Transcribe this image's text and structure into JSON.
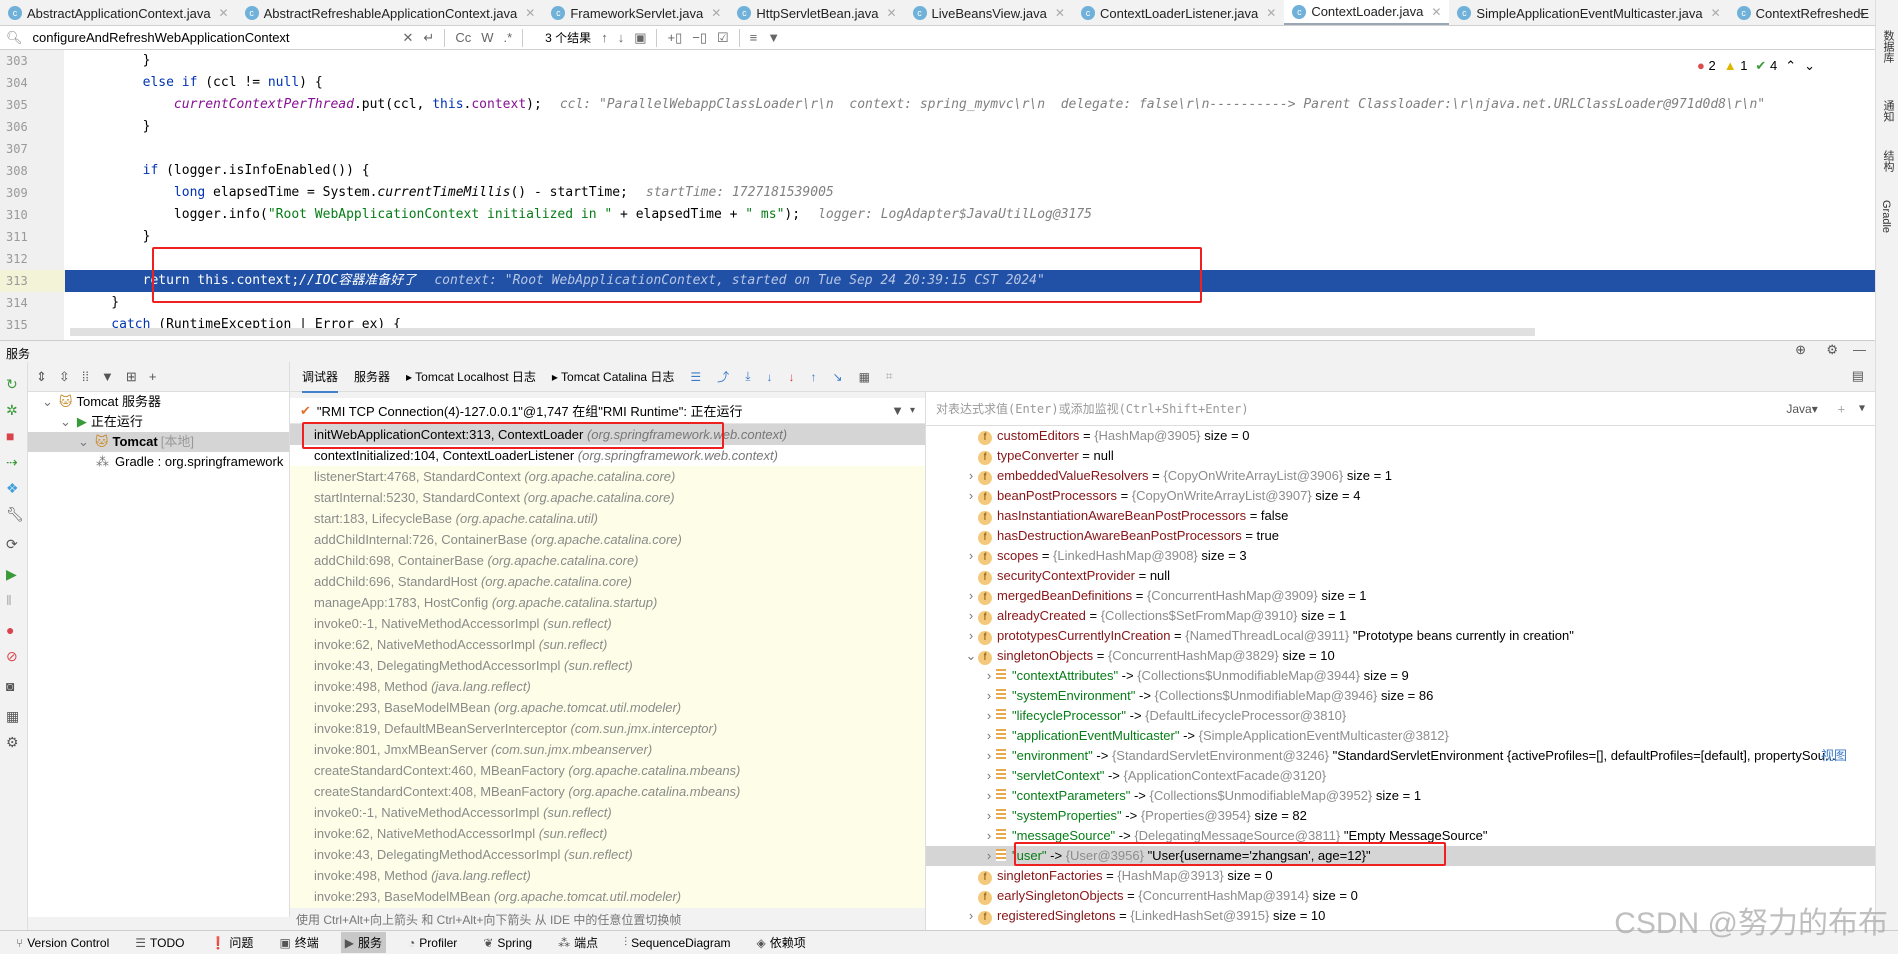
{
  "tabs": [
    {
      "label": "AbstractApplicationContext.java",
      "active": false
    },
    {
      "label": "AbstractRefreshableApplicationContext.java",
      "active": false
    },
    {
      "label": "FrameworkServlet.java",
      "active": false
    },
    {
      "label": "HttpServletBean.java",
      "active": false
    },
    {
      "label": "LiveBeansView.java",
      "active": false
    },
    {
      "label": "ContextLoaderListener.java",
      "active": false
    },
    {
      "label": "ContextLoader.java",
      "active": true
    },
    {
      "label": "SimpleApplicationEventMulticaster.java",
      "active": false
    },
    {
      "label": "ContextRefreshedE",
      "active": false
    }
  ],
  "search": {
    "value": "configureAndRefreshWebApplicationContext",
    "results": "3 个结果",
    "cc": "Cc",
    "w": "W",
    "regex": ".*"
  },
  "inspections": {
    "errors": "2",
    "warnings": "1",
    "ok": "4"
  },
  "code": [
    {
      "n": "303",
      "segs": [
        {
          "k": "",
          "t": "        }"
        }
      ]
    },
    {
      "n": "304",
      "segs": [
        {
          "k": "kw",
          "t": "        else if"
        },
        {
          "k": "",
          "t": " (ccl != "
        },
        {
          "k": "kw",
          "t": "null"
        },
        {
          "k": "",
          "t": ") {"
        }
      ]
    },
    {
      "n": "305",
      "segs": [
        {
          "k": "fld it",
          "t": "            currentContextPerThread"
        },
        {
          "k": "",
          "t": ".put(ccl, "
        },
        {
          "k": "kw",
          "t": "this"
        },
        {
          "k": "",
          "t": "."
        },
        {
          "k": "fld",
          "t": "context"
        },
        {
          "k": "",
          "t": ");"
        },
        {
          "k": "hint",
          "t": "ccl: \"ParallelWebappClassLoader\\r\\n  context: spring_mymvc\\r\\n  delegate: false\\r\\n----------> Parent Classloader:\\r\\njava.net.URLClassLoader@971d0d8\\r\\n\""
        }
      ]
    },
    {
      "n": "306",
      "segs": [
        {
          "k": "",
          "t": "        }"
        }
      ]
    },
    {
      "n": "307",
      "segs": []
    },
    {
      "n": "308",
      "segs": [
        {
          "k": "kw",
          "t": "        if"
        },
        {
          "k": "",
          "t": " (logger.isInfoEnabled()) {"
        }
      ]
    },
    {
      "n": "309",
      "segs": [
        {
          "k": "kw",
          "t": "            long"
        },
        {
          "k": "",
          "t": " elapsedTime = System."
        },
        {
          "k": "it",
          "t": "currentTimeMillis"
        },
        {
          "k": "",
          "t": "() - startTime;"
        },
        {
          "k": "hint",
          "t": "startTime: 1727181539005"
        }
      ]
    },
    {
      "n": "310",
      "segs": [
        {
          "k": "",
          "t": "            logger.info("
        },
        {
          "k": "str",
          "t": "\"Root WebApplicationContext initialized in \""
        },
        {
          "k": "",
          "t": " + elapsedTime + "
        },
        {
          "k": "str",
          "t": "\" ms\""
        },
        {
          "k": "",
          "t": ");"
        },
        {
          "k": "hint",
          "t": "logger: LogAdapter$JavaUtilLog@3175"
        }
      ]
    },
    {
      "n": "311",
      "segs": [
        {
          "k": "",
          "t": "        }"
        }
      ]
    },
    {
      "n": "312",
      "segs": []
    },
    {
      "n": "313",
      "cur": true,
      "segs": [
        {
          "k": "kw",
          "t": "        return this"
        },
        {
          "k": "",
          "t": ".context;"
        },
        {
          "k": "it",
          "t": "//IOC容器准备好了"
        },
        {
          "k": "hint",
          "t": "context: \"Root WebApplicationContext, started on Tue Sep 24 20:39:15 CST 2024\""
        }
      ]
    },
    {
      "n": "314",
      "segs": [
        {
          "k": "",
          "t": "    }"
        }
      ]
    },
    {
      "n": "315",
      "segs": [
        {
          "k": "kw",
          "t": "    catch"
        },
        {
          "k": "",
          "t": " (RuntimeException | Error ex) {"
        }
      ]
    }
  ],
  "services": {
    "title": "服务",
    "tree": [
      {
        "label": "Tomcat 服务器",
        "indent": 1
      },
      {
        "label": "正在运行",
        "indent": 2
      },
      {
        "label": "Tomcat",
        "extra": "[本地]",
        "indent": 3,
        "selected": true
      },
      {
        "label": "Gradle : org.springframework",
        "indent": 4
      }
    ]
  },
  "debug_tabs": [
    "调试器",
    "服务器",
    "Tomcat Localhost 日志",
    "Tomcat Catalina 日志"
  ],
  "thread": "\"RMI TCP Connection(4)-127.0.0.1\"@1,747 在组\"RMI Runtime\": 正在运行",
  "frames": [
    {
      "m": "initWebApplicationContext:313, ContextLoader",
      "p": "(org.springframework.web.context)"
    },
    {
      "m": "contextInitialized:104, ContextLoaderListener",
      "p": "(org.springframework.web.context)"
    },
    {
      "m": "listenerStart:4768, StandardContext",
      "p": "(org.apache.catalina.core)"
    },
    {
      "m": "startInternal:5230, StandardContext",
      "p": "(org.apache.catalina.core)"
    },
    {
      "m": "start:183, LifecycleBase",
      "p": "(org.apache.catalina.util)"
    },
    {
      "m": "addChildInternal:726, ContainerBase",
      "p": "(org.apache.catalina.core)"
    },
    {
      "m": "addChild:698, ContainerBase",
      "p": "(org.apache.catalina.core)"
    },
    {
      "m": "addChild:696, StandardHost",
      "p": "(org.apache.catalina.core)"
    },
    {
      "m": "manageApp:1783, HostConfig",
      "p": "(org.apache.catalina.startup)"
    },
    {
      "m": "invoke0:-1, NativeMethodAccessorImpl",
      "p": "(sun.reflect)"
    },
    {
      "m": "invoke:62, NativeMethodAccessorImpl",
      "p": "(sun.reflect)"
    },
    {
      "m": "invoke:43, DelegatingMethodAccessorImpl",
      "p": "(sun.reflect)"
    },
    {
      "m": "invoke:498, Method",
      "p": "(java.lang.reflect)"
    },
    {
      "m": "invoke:293, BaseModelMBean",
      "p": "(org.apache.tomcat.util.modeler)"
    },
    {
      "m": "invoke:819, DefaultMBeanServerInterceptor",
      "p": "(com.sun.jmx.interceptor)"
    },
    {
      "m": "invoke:801, JmxMBeanServer",
      "p": "(com.sun.jmx.mbeanserver)"
    },
    {
      "m": "createStandardContext:460, MBeanFactory",
      "p": "(org.apache.catalina.mbeans)"
    },
    {
      "m": "createStandardContext:408, MBeanFactory",
      "p": "(org.apache.catalina.mbeans)"
    },
    {
      "m": "invoke0:-1, NativeMethodAccessorImpl",
      "p": "(sun.reflect)"
    },
    {
      "m": "invoke:62, NativeMethodAccessorImpl",
      "p": "(sun.reflect)"
    },
    {
      "m": "invoke:43, DelegatingMethodAccessorImpl",
      "p": "(sun.reflect)"
    },
    {
      "m": "invoke:498, Method",
      "p": "(java.lang.reflect)"
    },
    {
      "m": "invoke:293, BaseModelMBean",
      "p": "(org.apache.tomcat.util.modeler)"
    }
  ],
  "frames_hint": "使用 Ctrl+Alt+向上箭头 和 Ctrl+Alt+向下箭头 从 IDE 中的任意位置切换帧",
  "expr_placeholder": "对表达式求值(Enter)或添加监视(Ctrl+Shift+Enter)",
  "expr_lang": "Java▾",
  "variables": [
    {
      "lvl": 0,
      "exp": "",
      "n": "customEditors",
      "t": "{HashMap@3905}",
      "v": "size = 0"
    },
    {
      "lvl": 0,
      "exp": "",
      "n": "typeConverter",
      "t": "",
      "v": "null"
    },
    {
      "lvl": 0,
      "exp": ">",
      "n": "embeddedValueResolvers",
      "t": "{CopyOnWriteArrayList@3906}",
      "v": "size = 1"
    },
    {
      "lvl": 0,
      "exp": ">",
      "n": "beanPostProcessors",
      "t": "{CopyOnWriteArrayList@3907}",
      "v": "size = 4"
    },
    {
      "lvl": 0,
      "exp": "",
      "n": "hasInstantiationAwareBeanPostProcessors",
      "t": "",
      "v": "false"
    },
    {
      "lvl": 0,
      "exp": "",
      "n": "hasDestructionAwareBeanPostProcessors",
      "t": "",
      "v": "true"
    },
    {
      "lvl": 0,
      "exp": ">",
      "n": "scopes",
      "t": "{LinkedHashMap@3908}",
      "v": "size = 3"
    },
    {
      "lvl": 0,
      "exp": "",
      "n": "securityContextProvider",
      "t": "",
      "v": "null"
    },
    {
      "lvl": 0,
      "exp": ">",
      "n": "mergedBeanDefinitions",
      "t": "{ConcurrentHashMap@3909}",
      "v": "size = 1"
    },
    {
      "lvl": 0,
      "exp": ">",
      "n": "alreadyCreated",
      "t": "{Collections$SetFromMap@3910}",
      "v": "size = 1"
    },
    {
      "lvl": 0,
      "exp": ">",
      "n": "prototypesCurrentlyInCreation",
      "t": "{NamedThreadLocal@3911}",
      "v": "\"Prototype beans currently in creation\""
    },
    {
      "lvl": 0,
      "exp": "v",
      "n": "singletonObjects",
      "t": "{ConcurrentHashMap@3829}",
      "v": "size = 10"
    },
    {
      "lvl": 1,
      "exp": ">",
      "n": "\"contextAttributes\"",
      "t": "{Collections$UnmodifiableMap@3944}",
      "v": "size = 9"
    },
    {
      "lvl": 1,
      "exp": ">",
      "n": "\"systemEnvironment\"",
      "t": "{Collections$UnmodifiableMap@3946}",
      "v": "size = 86"
    },
    {
      "lvl": 1,
      "exp": ">",
      "n": "\"lifecycleProcessor\"",
      "t": "{DefaultLifecycleProcessor@3810}",
      "v": ""
    },
    {
      "lvl": 1,
      "exp": ">",
      "n": "\"applicationEventMulticaster\"",
      "t": "{SimpleApplicationEventMulticaster@3812}",
      "v": ""
    },
    {
      "lvl": 1,
      "exp": ">",
      "n": "\"environment\"",
      "t": "{StandardServletEnvironment@3246}",
      "v": "\"StandardServletEnvironment {activeProfiles=[], defaultProfiles=[default], propertySou...",
      "link": "视图"
    },
    {
      "lvl": 1,
      "exp": ">",
      "n": "\"servletContext\"",
      "t": "{ApplicationContextFacade@3120}",
      "v": ""
    },
    {
      "lvl": 1,
      "exp": ">",
      "n": "\"contextParameters\"",
      "t": "{Collections$UnmodifiableMap@3952}",
      "v": "size = 1"
    },
    {
      "lvl": 1,
      "exp": ">",
      "n": "\"systemProperties\"",
      "t": "{Properties@3954}",
      "v": "size = 82"
    },
    {
      "lvl": 1,
      "exp": ">",
      "n": "\"messageSource\"",
      "t": "{DelegatingMessageSource@3811}",
      "v": "\"Empty MessageSource\""
    },
    {
      "lvl": 1,
      "exp": ">",
      "n": "\"user\"",
      "t": "{User@3956}",
      "v": "\"User{username='zhangsan', age=12}\"",
      "selected": true
    },
    {
      "lvl": 0,
      "exp": "",
      "n": "singletonFactories",
      "t": "{HashMap@3913}",
      "v": "size = 0"
    },
    {
      "lvl": 0,
      "exp": "",
      "n": "earlySingletonObjects",
      "t": "{ConcurrentHashMap@3914}",
      "v": "size = 0"
    },
    {
      "lvl": 0,
      "exp": ">",
      "n": "registeredSingletons",
      "t": "{LinkedHashSet@3915}",
      "v": "size = 10"
    }
  ],
  "right_strip": [
    "数据库",
    "通知",
    "结构",
    "Gradle"
  ],
  "status": [
    {
      "label": "Version Control",
      "icon": "branch-icon"
    },
    {
      "label": "TODO",
      "icon": "list-icon"
    },
    {
      "label": "问题",
      "icon": "problem-icon"
    },
    {
      "label": "终端",
      "icon": "terminal-icon"
    },
    {
      "label": "服务",
      "icon": "services-icon",
      "active": true
    },
    {
      "label": "Profiler",
      "icon": "profiler-icon"
    },
    {
      "label": "Spring",
      "icon": "spring-icon"
    },
    {
      "label": "端点",
      "icon": "endpoints-icon"
    },
    {
      "label": "SequenceDiagram",
      "icon": "sequence-icon"
    },
    {
      "label": "依赖项",
      "icon": "dependencies-icon"
    }
  ],
  "watermark": "CSDN @努力的布布",
  "colors": {
    "current_line": "#2151a6",
    "highlight_box": "#ee2020",
    "frames_bg": "#fefee8"
  }
}
